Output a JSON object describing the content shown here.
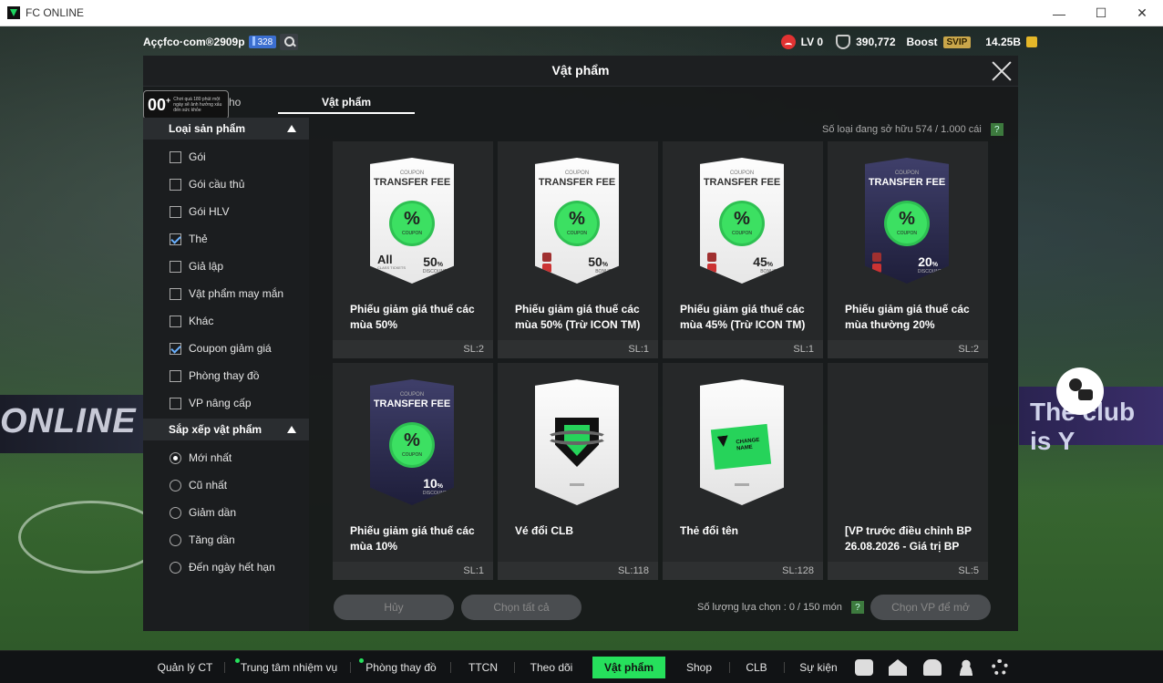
{
  "window": {
    "title": "FC ONLINE",
    "controls": [
      "—",
      "☐",
      "✕"
    ]
  },
  "topbar": {
    "account_name": "Aççfco·com®2909p",
    "level_badge": "328",
    "lv": "LV 0",
    "points": "390,772",
    "boost_label": "Boost",
    "svip_label": "SVIP",
    "currency": "14.25B"
  },
  "dialog": {
    "title": "Vật phẩm",
    "tab_kho": "Kho",
    "tab_vatpham": "Vật phẩm",
    "age_rating": "00",
    "age_plus": "+",
    "age_notice": "Chơi quá 180 phút một ngày sẽ ảnh hưởng xấu đến sức khỏe",
    "owned_label": "Số loại đang sở hữu  574 / 1.000 cái",
    "help": "?"
  },
  "sidebar": {
    "category_header": "Loại sản phẩm",
    "categories": [
      {
        "label": "Gói",
        "checked": false
      },
      {
        "label": "Gói cầu thủ",
        "checked": false
      },
      {
        "label": "Gói HLV",
        "checked": false
      },
      {
        "label": "Thẻ",
        "checked": true
      },
      {
        "label": "Giả lập",
        "checked": false
      },
      {
        "label": "Vật phẩm may mắn",
        "checked": false
      },
      {
        "label": "Khác",
        "checked": false
      },
      {
        "label": "Coupon giảm giá",
        "checked": true
      },
      {
        "label": "Phòng thay đồ",
        "checked": false
      },
      {
        "label": "VP nâng cấp",
        "checked": false
      }
    ],
    "sort_header": "Sắp xếp vật phẩm",
    "sorts": [
      {
        "label": "Mới nhất",
        "selected": true
      },
      {
        "label": "Cũ nhất",
        "selected": false
      },
      {
        "label": "Giảm dần",
        "selected": false
      },
      {
        "label": "Tăng dần",
        "selected": false
      },
      {
        "label": "Đến ngày hết hạn",
        "selected": false
      }
    ]
  },
  "items": [
    {
      "name": "Phiếu giảm giá thuế các mùa 50%",
      "qty": "SL:2",
      "kind": "coupon",
      "style": "white",
      "coupon_small": "COUPON",
      "coupon_title": "TRANSFER FEE",
      "pct": "%",
      "coupon_word": "COUPON",
      "value": "50",
      "unit": "%",
      "sub": "DISCOUNT",
      "all": "All",
      "all_sub": "CLASS TICKETS"
    },
    {
      "name": "Phiếu giảm giá thuế các mùa 50% (Trừ ICON TM)",
      "qty": "SL:1",
      "kind": "coupon",
      "style": "white",
      "coupon_small": "COUPON",
      "coupon_title": "TRANSFER FEE",
      "pct": "%",
      "coupon_word": "COUPON",
      "value": "50",
      "unit": "%",
      "sub": "BONUS"
    },
    {
      "name": "Phiếu giảm giá thuế các mùa 45% (Trừ ICON TM)",
      "qty": "SL:1",
      "kind": "coupon",
      "style": "white",
      "coupon_small": "COUPON",
      "coupon_title": "TRANSFER FEE",
      "pct": "%",
      "coupon_word": "COUPON",
      "value": "45",
      "unit": "%",
      "sub": "BONUS"
    },
    {
      "name": "Phiếu giảm giá thuế các mùa thường 20%",
      "qty": "SL:2",
      "kind": "coupon",
      "style": "dark",
      "coupon_small": "COUPON",
      "coupon_title": "TRANSFER FEE",
      "pct": "%",
      "coupon_word": "COUPON",
      "value": "20",
      "unit": "%",
      "sub": "DISCOUNT"
    },
    {
      "name": "Phiếu giảm giá thuế các mùa 10%",
      "qty": "SL:1",
      "kind": "coupon",
      "style": "dark",
      "coupon_small": "COUPON",
      "coupon_title": "TRANSFER FEE",
      "pct": "%",
      "coupon_word": "COUPON",
      "value": "10",
      "unit": "%",
      "sub": "DISCOUNT"
    },
    {
      "name": "Vé đổi CLB",
      "qty": "SL:118",
      "kind": "club"
    },
    {
      "name": "Thẻ đổi tên",
      "qty": "SL:128",
      "kind": "rename",
      "card_text": "CHANGE NAME"
    },
    {
      "name": "[VP trước điều chỉnh BP 26.08.2026 - Giá trị BP",
      "qty": "SL:5",
      "kind": "empty"
    }
  ],
  "footer": {
    "cancel": "Hủy",
    "select_all": "Chọn tất cả",
    "select_count": "Số lượng lựa chọn : 0 / 150 món",
    "choose": "Chọn VP để mở"
  },
  "stadium": {
    "banner_left": "ONLINE",
    "banner_right": "The club is Y"
  },
  "nav": [
    {
      "label": "Quản lý CT",
      "dot": false,
      "active": false
    },
    {
      "label": "Trung tâm nhiệm vụ",
      "dot": true,
      "active": false
    },
    {
      "label": "Phòng thay đồ",
      "dot": true,
      "active": false
    },
    {
      "label": "TTCN",
      "dot": false,
      "active": false
    },
    {
      "label": "Theo dõi",
      "dot": false,
      "active": false
    },
    {
      "label": "Vật phẩm",
      "dot": false,
      "active": true
    },
    {
      "label": "Shop",
      "dot": false,
      "active": false
    },
    {
      "label": "CLB",
      "dot": false,
      "active": false
    },
    {
      "label": "Sự kiện",
      "dot": false,
      "active": false
    }
  ],
  "nav_icons": [
    "chat-icon",
    "home-icon",
    "bell-icon",
    "user-icon",
    "gear-icon"
  ],
  "colors": {
    "accent": "#26e05c",
    "dialog_bg": "#181a1b",
    "card_bg": "#262829"
  }
}
